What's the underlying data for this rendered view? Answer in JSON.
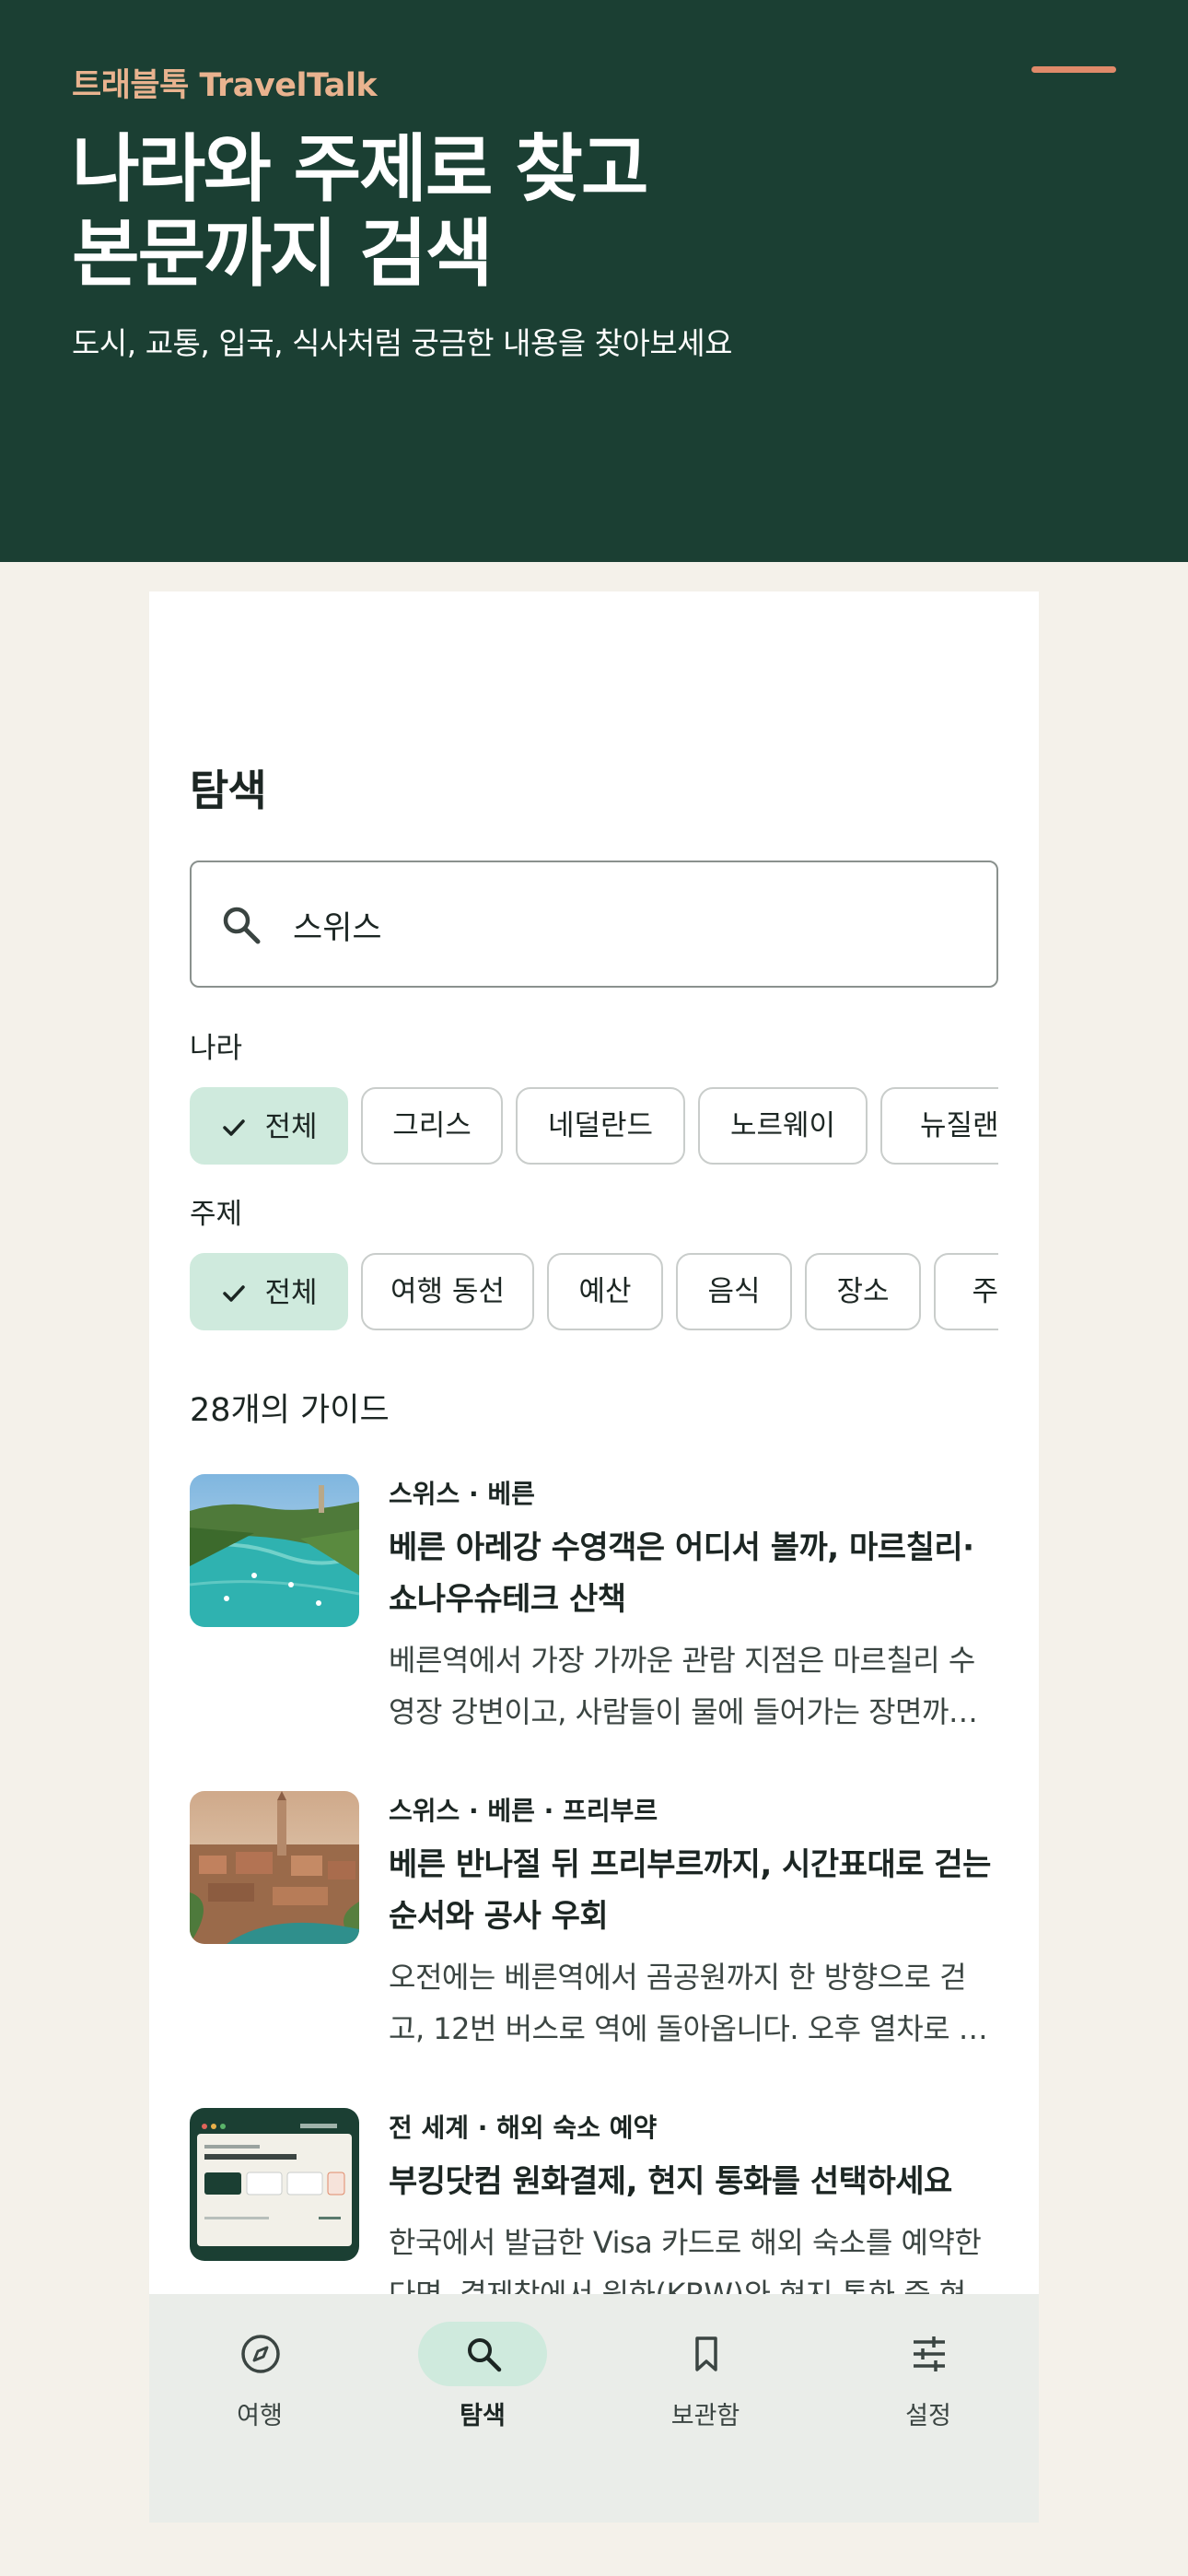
{
  "hero": {
    "brand": "트래블톡 TravelTalk",
    "title_line1": "나라와 주제로 찾고",
    "title_line2": "본문까지 검색",
    "subtitle": "도시, 교통, 입국, 식사처럼 궁금한 내용을 찾아보세요"
  },
  "search": {
    "section_title": "탐색",
    "query": "스위스",
    "icon": "search-icon"
  },
  "filters": {
    "country_label": "나라",
    "countries": [
      "전체",
      "그리스",
      "네덜란드",
      "노르웨이",
      "뉴질랜드"
    ],
    "country_selected": "전체",
    "topic_label": "주제",
    "topics": [
      "전체",
      "여행 동선",
      "예산",
      "음식",
      "장소",
      "주제"
    ],
    "topic_selected": "전체"
  },
  "results": {
    "count_label": "28개의 가이드",
    "items": [
      {
        "meta": "스위스 · 베른",
        "title": "베른 아레강 수영객은 어디서 볼까, 마르칠리·쇼나우슈테크 산책",
        "excerpt": "베른역에서 가장 가까운 관람 지점은 마르칠리 수영장 강변이고, 사람들이 물에 들어가는 장면까지 ..."
      },
      {
        "meta": "스위스 · 베른 · 프리부르",
        "title": "베른 반나절 뒤 프리부르까지, 시간표대로 걷는 순서와 공사 우회",
        "excerpt": "오전에는 베른역에서 곰공원까지 한 방향으로 걷고, 12번 버스로 역에 돌아옵니다. 오후 열차로 프리부르로 이동합니다."
      },
      {
        "meta": "전 세계 · 해외 숙소 예약",
        "title": "부킹닷컴 원화결제, 현지 통화를 선택하세요",
        "excerpt": "한국에서 발급한 Visa 카드로 해외 숙소를 예약한다면, 결제창에서 원화(KRW)와 현지 통화 중 현지 통화를 고르세요."
      }
    ]
  },
  "nav": {
    "items": [
      {
        "label": "여행",
        "icon": "compass-icon"
      },
      {
        "label": "탐색",
        "icon": "search-icon"
      },
      {
        "label": "보관함",
        "icon": "bookmark-icon"
      },
      {
        "label": "설정",
        "icon": "sliders-icon"
      }
    ],
    "active": "탐색"
  },
  "colors": {
    "hero_bg": "#1b3f33",
    "brand": "#e9b38f",
    "accent": "#e08a6a",
    "chip_selected": "#cfeadd",
    "page_bg": "#f4f1ea",
    "nav_bg": "#eaede9"
  }
}
